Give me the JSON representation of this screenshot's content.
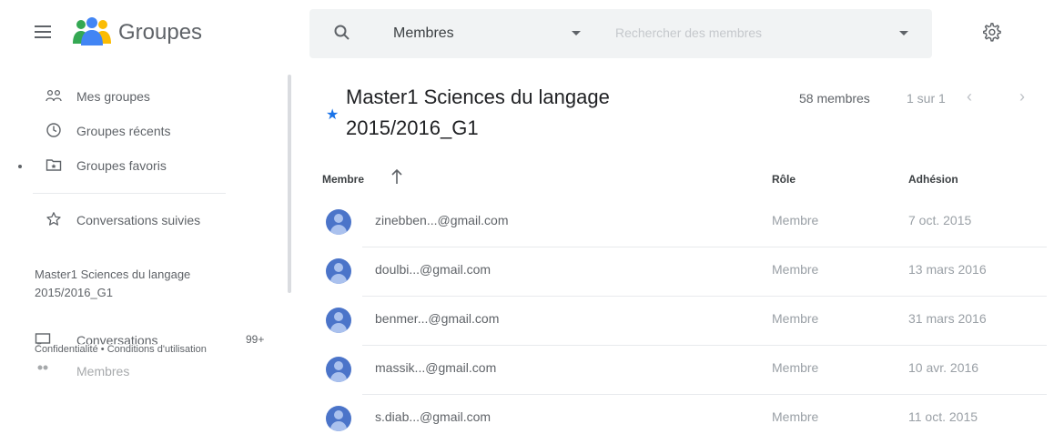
{
  "header": {
    "app_title": "Groupes",
    "search_scope": "Membres",
    "search_placeholder": "Rechercher des membres"
  },
  "sidebar": {
    "items": [
      {
        "label": "Mes groupes",
        "icon": "groups-icon"
      },
      {
        "label": "Groupes récents",
        "icon": "clock-icon"
      },
      {
        "label": "Groupes favoris",
        "icon": "folder-star-icon"
      },
      {
        "label": "Conversations suivies",
        "icon": "star-outline-icon"
      }
    ],
    "group_name": "Master1 Sciences du langage 2015/2016_G1",
    "group_items": [
      {
        "label": "Conversations",
        "count": "99+",
        "icon": "conversations-icon"
      },
      {
        "label": "Membres",
        "icon": "members-icon"
      }
    ],
    "footer": {
      "privacy": "Confidentialité",
      "separator": "•",
      "terms": "Conditions d'utilisation"
    }
  },
  "main": {
    "group_title": "Master1 Sciences du langage 2015/2016_G1",
    "member_count": "58 membres",
    "pagination": "1 sur 1",
    "columns": {
      "member": "Membre",
      "role": "Rôle",
      "joined": "Adhésion"
    },
    "members": [
      {
        "email": "zinebben...@gmail.com",
        "role": "Membre",
        "joined": "7 oct. 2015"
      },
      {
        "email": "doulbi...@gmail.com",
        "role": "Membre",
        "joined": "13 mars 2016"
      },
      {
        "email": "benmer...@gmail.com",
        "role": "Membre",
        "joined": "31 mars 2016"
      },
      {
        "email": "massik...@gmail.com",
        "role": "Membre",
        "joined": "10 avr. 2016"
      },
      {
        "email": "s.diab...@gmail.com",
        "role": "Membre",
        "joined": "11 oct. 2015"
      }
    ]
  },
  "colors": {
    "accent": "#1a73e8",
    "avatar": "#4b74c9",
    "logo_blue": "#4285f4",
    "logo_green": "#34a853",
    "logo_yellow": "#fbbc04"
  }
}
